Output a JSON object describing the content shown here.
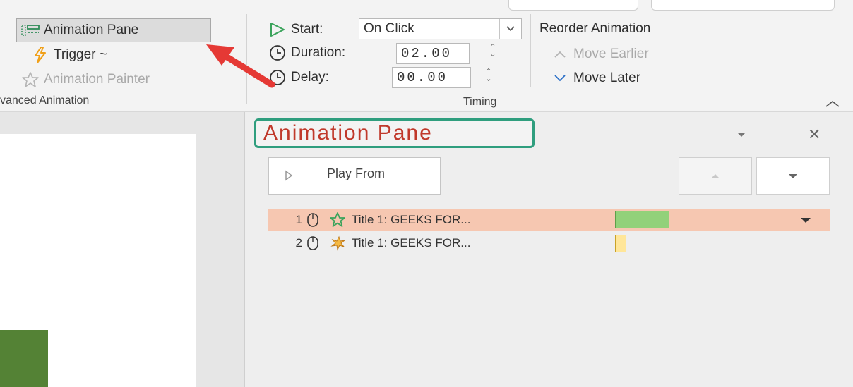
{
  "ribbon": {
    "advanced_animation": {
      "animation_pane_label": "Animation Pane",
      "trigger_label": "Trigger ~",
      "animation_painter_label": "Animation Painter",
      "group_label": "vanced Animation"
    },
    "timing": {
      "start_label": "Start:",
      "start_value": "On Click",
      "duration_label": "Duration:",
      "duration_value": "02.00",
      "delay_label": "Delay:",
      "delay_value": "00.00",
      "group_label": "Timing"
    },
    "reorder": {
      "title": "Reorder Animation",
      "move_earlier_label": "Move Earlier",
      "move_later_label": "Move Later"
    }
  },
  "animation_pane": {
    "title": "Animation Pane",
    "play_from_label": "Play From",
    "items": [
      {
        "number": "1",
        "label": "Title 1: GEEKS FOR...",
        "selected": true,
        "bar_color": "#92d17a"
      },
      {
        "number": "2",
        "label": "Title 1: GEEKS FOR...",
        "selected": false,
        "bar_color": "#ffe699"
      }
    ]
  },
  "icons": {
    "animation_pane": "animation-pane-icon",
    "trigger": "lightning-icon",
    "painter": "star-brush-icon",
    "start": "play-triangle-icon",
    "duration": "clock-icon",
    "delay": "clock-icon",
    "move_earlier": "chevron-up-icon",
    "move_later": "chevron-down-icon",
    "close": "close-icon"
  },
  "colors": {
    "selected_row": "#f6c7b1",
    "title_highlight": "#2f9e7e",
    "title_text": "#c0392b",
    "arrow": "#e53935"
  }
}
